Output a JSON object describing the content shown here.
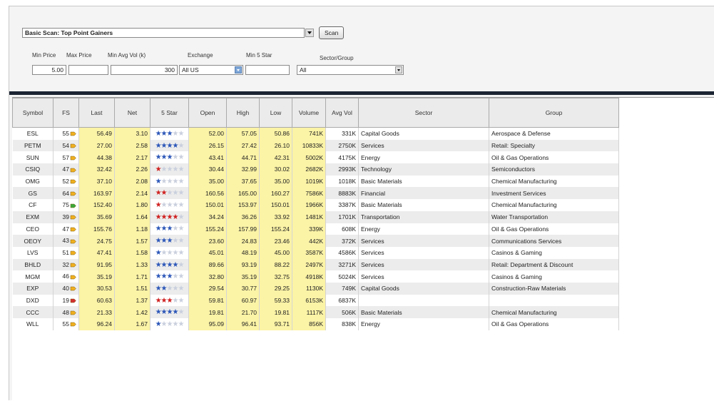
{
  "scan": {
    "selected": "Basic Scan: Top Point Gainers",
    "button": "Scan"
  },
  "filters": {
    "min_price": {
      "label": "Min Price",
      "value": "5.00"
    },
    "max_price": {
      "label": "Max Price",
      "value": ""
    },
    "min_avg_vol": {
      "label": "Min Avg Vol (k)",
      "value": "300"
    },
    "exchange": {
      "label": "Exchange",
      "value": "All US"
    },
    "min_5_star": {
      "label": "Min 5 Star",
      "value": ""
    },
    "sector_group": {
      "label": "Sector/Group",
      "value": "All"
    }
  },
  "columns": [
    "Symbol",
    "FS",
    "Last",
    "Net",
    "5 Star",
    "Open",
    "High",
    "Low",
    "Volume",
    "Avg Vol",
    "Sector",
    "Group"
  ],
  "colors": {
    "stars_on": "#2b56b8",
    "stars_red": "#d02020",
    "fs_yellow": "#f0b020",
    "fs_green": "#3aa83a",
    "fs_red": "#d32f2f",
    "highlight": "#fbf3a6"
  },
  "rows": [
    {
      "symbol": "ESL",
      "fs": "55",
      "fs_icon": "yellow-hand-icon",
      "last": "56.49",
      "net": "3.10",
      "stars": 3,
      "star_color": "blue",
      "open": "52.00",
      "high": "57.05",
      "low": "50.86",
      "volume": "741K",
      "avg_vol": "331K",
      "sector": "Capital Goods",
      "group": "Aerospace & Defense"
    },
    {
      "symbol": "PETM",
      "fs": "54",
      "fs_icon": "yellow-hand-icon",
      "last": "27.00",
      "net": "2.58",
      "stars": 4,
      "star_color": "blue",
      "open": "26.15",
      "high": "27.42",
      "low": "26.10",
      "volume": "10833K",
      "avg_vol": "2750K",
      "sector": "Services",
      "group": "Retail: Specialty"
    },
    {
      "symbol": "SUN",
      "fs": "57",
      "fs_icon": "yellow-hand-icon",
      "last": "44.38",
      "net": "2.17",
      "stars": 3,
      "star_color": "blue",
      "open": "43.41",
      "high": "44.71",
      "low": "42.31",
      "volume": "5002K",
      "avg_vol": "4175K",
      "sector": "Energy",
      "group": "Oil & Gas Operations"
    },
    {
      "symbol": "CSIQ",
      "fs": "47",
      "fs_icon": "yellow-hand-icon",
      "last": "32.42",
      "net": "2.26",
      "stars": 1,
      "star_color": "red",
      "open": "30.44",
      "high": "32.99",
      "low": "30.02",
      "volume": "2682K",
      "avg_vol": "2993K",
      "sector": "Technology",
      "group": "Semiconductors"
    },
    {
      "symbol": "OMG",
      "fs": "52",
      "fs_icon": "yellow-hand-icon",
      "last": "37.10",
      "net": "2.08",
      "stars": 1,
      "star_color": "blue",
      "open": "35.00",
      "high": "37.65",
      "low": "35.00",
      "volume": "1019K",
      "avg_vol": "1018K",
      "sector": "Basic Materials",
      "group": "Chemical Manufacturing"
    },
    {
      "symbol": "GS",
      "fs": "64",
      "fs_icon": "yellow-hand-icon",
      "last": "163.97",
      "net": "2.14",
      "stars": 2,
      "star_color": "red",
      "open": "160.56",
      "high": "165.00",
      "low": "160.27",
      "volume": "7586K",
      "avg_vol": "8883K",
      "sector": "Financial",
      "group": "Investment Services"
    },
    {
      "symbol": "CF",
      "fs": "75",
      "fs_icon": "green-thumbs-up-icon",
      "last": "152.40",
      "net": "1.80",
      "stars": 1,
      "star_color": "red",
      "open": "150.01",
      "high": "153.97",
      "low": "150.01",
      "volume": "1966K",
      "avg_vol": "3387K",
      "sector": "Basic Materials",
      "group": "Chemical Manufacturing"
    },
    {
      "symbol": "EXM",
      "fs": "39",
      "fs_icon": "yellow-hand-icon",
      "last": "35.69",
      "net": "1.64",
      "stars": 4,
      "star_color": "red",
      "open": "34.24",
      "high": "36.26",
      "low": "33.92",
      "volume": "1481K",
      "avg_vol": "1701K",
      "sector": "Transportation",
      "group": "Water Transportation"
    },
    {
      "symbol": "CEO",
      "fs": "47",
      "fs_icon": "yellow-hand-icon",
      "last": "155.76",
      "net": "1.18",
      "stars": 3,
      "star_color": "blue",
      "open": "155.24",
      "high": "157.99",
      "low": "155.24",
      "volume": "339K",
      "avg_vol": "608K",
      "sector": "Energy",
      "group": "Oil & Gas Operations"
    },
    {
      "symbol": "OEOY",
      "fs": "43",
      "fs_icon": "yellow-hand-icon",
      "last": "24.75",
      "net": "1.57",
      "stars": 3,
      "star_color": "blue",
      "open": "23.60",
      "high": "24.83",
      "low": "23.46",
      "volume": "442K",
      "avg_vol": "372K",
      "sector": "Services",
      "group": "Communications Services"
    },
    {
      "symbol": "LVS",
      "fs": "51",
      "fs_icon": "yellow-hand-icon",
      "last": "47.41",
      "net": "1.58",
      "stars": 1,
      "star_color": "blue",
      "open": "45.01",
      "high": "48.19",
      "low": "45.00",
      "volume": "3587K",
      "avg_vol": "4586K",
      "sector": "Services",
      "group": "Casinos & Gaming"
    },
    {
      "symbol": "BHLD",
      "fs": "32",
      "fs_icon": "yellow-hand-icon",
      "last": "91.95",
      "net": "1.33",
      "stars": 4,
      "star_color": "blue",
      "open": "89.66",
      "high": "93.19",
      "low": "88.22",
      "volume": "2497K",
      "avg_vol": "3271K",
      "sector": "Services",
      "group": "Retail: Department & Discount"
    },
    {
      "symbol": "MGM",
      "fs": "46",
      "fs_icon": "yellow-hand-icon",
      "last": "35.19",
      "net": "1.71",
      "stars": 3,
      "star_color": "blue",
      "open": "32.80",
      "high": "35.19",
      "low": "32.75",
      "volume": "4918K",
      "avg_vol": "5024K",
      "sector": "Services",
      "group": "Casinos & Gaming"
    },
    {
      "symbol": "EXP",
      "fs": "40",
      "fs_icon": "yellow-hand-icon",
      "last": "30.53",
      "net": "1.51",
      "stars": 2,
      "star_color": "blue",
      "open": "29.54",
      "high": "30.77",
      "low": "29.25",
      "volume": "1130K",
      "avg_vol": "749K",
      "sector": "Capital Goods",
      "group": "Construction-Raw Materials"
    },
    {
      "symbol": "DXD",
      "fs": "19",
      "fs_icon": "red-thumbs-down-icon",
      "last": "60.63",
      "net": "1.37",
      "stars": 3,
      "star_color": "red",
      "open": "59.81",
      "high": "60.97",
      "low": "59.33",
      "volume": "6153K",
      "avg_vol": "6837K",
      "sector": "",
      "group": ""
    },
    {
      "symbol": "CCC",
      "fs": "48",
      "fs_icon": "yellow-hand-icon",
      "last": "21.33",
      "net": "1.42",
      "stars": 4,
      "star_color": "blue",
      "open": "19.81",
      "high": "21.70",
      "low": "19.81",
      "volume": "1117K",
      "avg_vol": "506K",
      "sector": "Basic Materials",
      "group": "Chemical Manufacturing"
    },
    {
      "symbol": "WLL",
      "fs": "55",
      "fs_icon": "yellow-hand-icon",
      "last": "96.24",
      "net": "1.67",
      "stars": 1,
      "star_color": "blue",
      "open": "95.09",
      "high": "96.41",
      "low": "93.71",
      "volume": "856K",
      "avg_vol": "838K",
      "sector": "Energy",
      "group": "Oil & Gas Operations"
    }
  ]
}
